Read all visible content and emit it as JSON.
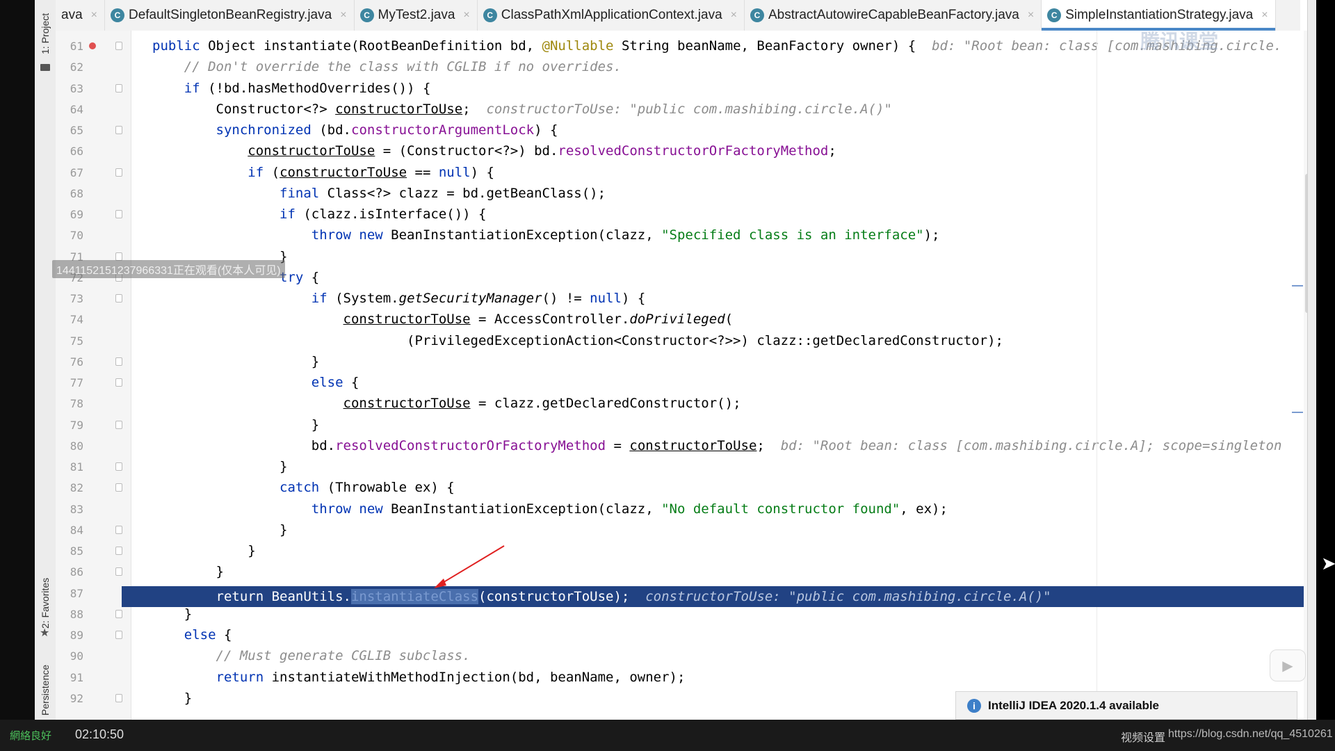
{
  "tabs": [
    {
      "label": "ava",
      "icon": "none",
      "closable": true,
      "active": false
    },
    {
      "label": "DefaultSingletonBeanRegistry.java",
      "icon": "C",
      "closable": true,
      "active": false
    },
    {
      "label": "MyTest2.java",
      "icon": "C",
      "closable": true,
      "active": false
    },
    {
      "label": "ClassPathXmlApplicationContext.java",
      "icon": "C",
      "closable": true,
      "active": false
    },
    {
      "label": "AbstractAutowireCapableBeanFactory.java",
      "icon": "C",
      "closable": true,
      "active": false
    },
    {
      "label": "SimpleInstantiationStrategy.java",
      "icon": "C",
      "closable": true,
      "active": true
    }
  ],
  "tool_windows": {
    "project": "1: Project",
    "favorites": "2: Favorites",
    "persistence": "Persistence"
  },
  "code_lines": [
    {
      "n": "61",
      "html_key": "l61"
    },
    {
      "n": "62",
      "html_key": "l62"
    },
    {
      "n": "63",
      "html_key": "l63"
    },
    {
      "n": "64",
      "html_key": "l64"
    },
    {
      "n": "65",
      "html_key": "l65"
    },
    {
      "n": "66",
      "html_key": "l66"
    },
    {
      "n": "67",
      "html_key": "l67"
    },
    {
      "n": "68",
      "html_key": "l68"
    },
    {
      "n": "69",
      "html_key": "l69"
    },
    {
      "n": "70",
      "html_key": "l70"
    },
    {
      "n": "71",
      "html_key": "l71"
    },
    {
      "n": "72",
      "html_key": "l72"
    },
    {
      "n": "73",
      "html_key": "l73"
    },
    {
      "n": "74",
      "html_key": "l74"
    },
    {
      "n": "75",
      "html_key": "l75"
    },
    {
      "n": "76",
      "html_key": "l76"
    },
    {
      "n": "77",
      "html_key": "l77"
    },
    {
      "n": "78",
      "html_key": "l78"
    },
    {
      "n": "79",
      "html_key": "l79"
    },
    {
      "n": "80",
      "html_key": "l80"
    },
    {
      "n": "81",
      "html_key": "l81"
    },
    {
      "n": "82",
      "html_key": "l82"
    },
    {
      "n": "83",
      "html_key": "l83"
    },
    {
      "n": "84",
      "html_key": "l84"
    },
    {
      "n": "85",
      "html_key": "l85"
    },
    {
      "n": "86",
      "html_key": "l86"
    },
    {
      "n": "87",
      "html_key": "l87"
    },
    {
      "n": "88",
      "html_key": "l88"
    },
    {
      "n": "89",
      "html_key": "l89"
    },
    {
      "n": "90",
      "html_key": "l90"
    },
    {
      "n": "91",
      "html_key": "l91"
    },
    {
      "n": "92",
      "html_key": "l92"
    }
  ],
  "code": {
    "l61": [
      [
        "kw",
        "public "
      ],
      [
        "",
        "Object "
      ],
      [
        "",
        "instantiate"
      ],
      [
        "",
        "(RootBeanDefinition bd, "
      ],
      [
        "ann",
        "@Nullable"
      ],
      [
        "",
        " String beanName, BeanFactory owner) {  "
      ],
      [
        "hint",
        "bd: \"Root bean: class [com.mashibing.circle."
      ]
    ],
    "l62": [
      [
        "cm",
        "    // Don't override the class with CGLIB if no overrides."
      ]
    ],
    "l63": [
      [
        "",
        "    "
      ],
      [
        "kw",
        "if "
      ],
      [
        "",
        "(!bd.hasMethodOverrides()) {"
      ]
    ],
    "l64": [
      [
        "",
        "        Constructor<?> "
      ],
      [
        "u",
        "constructorToUse"
      ],
      [
        "",
        ";  "
      ],
      [
        "hint",
        "constructorToUse: \"public com.mashibing.circle.A()\""
      ]
    ],
    "l65": [
      [
        "",
        "        "
      ],
      [
        "kw",
        "synchronized "
      ],
      [
        "",
        "(bd."
      ],
      [
        "fld",
        "constructorArgumentLock"
      ],
      [
        "",
        ") {"
      ]
    ],
    "l66": [
      [
        "",
        "            "
      ],
      [
        "u",
        "constructorToUse"
      ],
      [
        "",
        " = (Constructor<?>) bd."
      ],
      [
        "fld",
        "resolvedConstructorOrFactoryMethod"
      ],
      [
        "",
        ";"
      ]
    ],
    "l67": [
      [
        "",
        "            "
      ],
      [
        "kw",
        "if "
      ],
      [
        "",
        "("
      ],
      [
        "u",
        "constructorToUse"
      ],
      [
        "",
        " == "
      ],
      [
        "kw",
        "null"
      ],
      [
        "",
        ") {"
      ]
    ],
    "l68": [
      [
        "",
        "                "
      ],
      [
        "kw",
        "final "
      ],
      [
        "",
        "Class<?> clazz = bd.getBeanClass();"
      ]
    ],
    "l69": [
      [
        "",
        "                "
      ],
      [
        "kw",
        "if "
      ],
      [
        "",
        "(clazz.isInterface()) {"
      ]
    ],
    "l70": [
      [
        "",
        "                    "
      ],
      [
        "kw",
        "throw new "
      ],
      [
        "",
        "BeanInstantiationException(clazz, "
      ],
      [
        "str",
        "\"Specified class is an interface\""
      ],
      [
        "",
        ");"
      ]
    ],
    "l71": [
      [
        "",
        "                }"
      ]
    ],
    "l72": [
      [
        "",
        "                "
      ],
      [
        "kw",
        "try "
      ],
      [
        "",
        "{"
      ]
    ],
    "l73": [
      [
        "",
        "                    "
      ],
      [
        "kw",
        "if "
      ],
      [
        "",
        "(System."
      ],
      [
        "it",
        "getSecurityManager"
      ],
      [
        "",
        "() != "
      ],
      [
        "kw",
        "null"
      ],
      [
        "",
        ") {"
      ]
    ],
    "l74": [
      [
        "",
        "                        "
      ],
      [
        "u",
        "constructorToUse"
      ],
      [
        "",
        " = AccessController."
      ],
      [
        "it",
        "doPrivileged"
      ],
      [
        "",
        "("
      ]
    ],
    "l75": [
      [
        "",
        "                                (PrivilegedExceptionAction<Constructor<?>>) clazz::getDeclaredConstructor);"
      ]
    ],
    "l76": [
      [
        "",
        "                    }"
      ]
    ],
    "l77": [
      [
        "",
        "                    "
      ],
      [
        "kw",
        "else "
      ],
      [
        "",
        "{"
      ]
    ],
    "l78": [
      [
        "",
        "                        "
      ],
      [
        "u",
        "constructorToUse"
      ],
      [
        "",
        " = clazz.getDeclaredConstructor();"
      ]
    ],
    "l79": [
      [
        "",
        "                    }"
      ]
    ],
    "l80": [
      [
        "",
        "                    bd."
      ],
      [
        "fld",
        "resolvedConstructorOrFactoryMethod"
      ],
      [
        "",
        " = "
      ],
      [
        "u",
        "constructorToUse"
      ],
      [
        "",
        ";  "
      ],
      [
        "hint",
        "bd: \"Root bean: class [com.mashibing.circle.A]; scope=singleton"
      ]
    ],
    "l81": [
      [
        "",
        "                }"
      ]
    ],
    "l82": [
      [
        "",
        "                "
      ],
      [
        "kw",
        "catch "
      ],
      [
        "",
        "(Throwable ex) {"
      ]
    ],
    "l83": [
      [
        "",
        "                    "
      ],
      [
        "kw",
        "throw new "
      ],
      [
        "",
        "BeanInstantiationException(clazz, "
      ],
      [
        "str",
        "\"No default constructor found\""
      ],
      [
        "",
        ", ex);"
      ]
    ],
    "l84": [
      [
        "",
        "                }"
      ]
    ],
    "l85": [
      [
        "",
        "            }"
      ]
    ],
    "l86": [
      [
        "",
        "        }"
      ]
    ],
    "l87": [
      [
        "",
        "        return BeanUtils."
      ],
      [
        "sel",
        "instantiateClass"
      ],
      [
        "",
        "(constructorToUse);  "
      ],
      [
        "hlhint",
        "constructorToUse: \"public com.mashibing.circle.A()\""
      ]
    ],
    "l88": [
      [
        "",
        "    }"
      ]
    ],
    "l89": [
      [
        "",
        "    "
      ],
      [
        "kw",
        "else "
      ],
      [
        "",
        "{"
      ]
    ],
    "l90": [
      [
        "cm",
        "        // Must generate CGLIB subclass."
      ]
    ],
    "l91": [
      [
        "",
        "        "
      ],
      [
        "kw",
        "return "
      ],
      [
        "",
        "instantiateWithMethodInjection(bd, beanName, owner);"
      ]
    ],
    "l92": [
      [
        "",
        "    }"
      ]
    ]
  },
  "overlay_watermark": "1441152151237966331正在观看(仅本人可见)",
  "logo_watermark": "腾讯课堂",
  "notification": {
    "text": "IntelliJ IDEA 2020.1.4 available"
  },
  "player": {
    "network": "網絡良好",
    "time": "02:10:50",
    "settings": "视频设置",
    "url": "https://blog.csdn.net/qq_4510261"
  },
  "colors": {
    "keyword": "#0033b3",
    "string": "#067d17",
    "field": "#871094",
    "selection_row": "#214283"
  }
}
